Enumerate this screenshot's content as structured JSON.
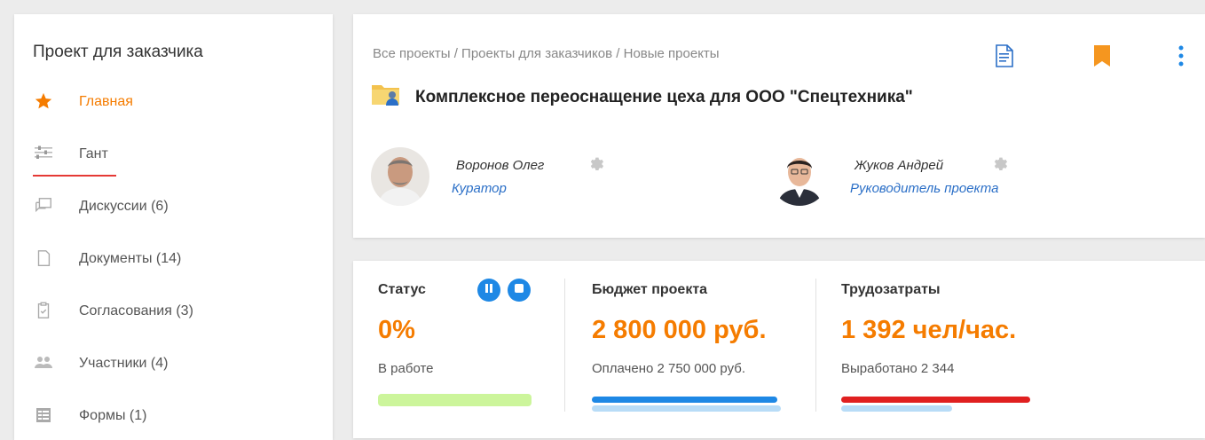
{
  "sidebar": {
    "title": "Проект для заказчика",
    "items": [
      {
        "label": "Главная",
        "icon": "star-icon"
      },
      {
        "label": "Гант",
        "icon": "gantt-icon"
      },
      {
        "label": "Дискуссии (6)",
        "icon": "discussions-icon"
      },
      {
        "label": "Документы (14)",
        "icon": "documents-icon"
      },
      {
        "label": "Согласования (3)",
        "icon": "approvals-icon"
      },
      {
        "label": "Участники (4)",
        "icon": "participants-icon"
      },
      {
        "label": "Формы (1)",
        "icon": "forms-icon"
      }
    ]
  },
  "header": {
    "breadcrumb": "Все проекты / Проекты для заказчиков / Новые проекты",
    "title": "Комплексное переоснащение цеха для ООО \"Спецтехника\"",
    "actions": [
      "document-icon",
      "bookmark-icon",
      "more-vertical-icon"
    ]
  },
  "people": [
    {
      "name": "Воронов Олег",
      "role": "Куратор"
    },
    {
      "name": "Жуков Андрей",
      "role": "Руководитель проекта"
    }
  ],
  "stats": {
    "status": {
      "title": "Статус",
      "value": "0%",
      "sub": "В работе",
      "progress": 0.0
    },
    "budget": {
      "title": "Бюджет проекта",
      "value": "2 800 000 руб.",
      "sub": "Оплачено 2 750 000 руб.",
      "paid_fraction": 0.98
    },
    "labor": {
      "title": "Трудозатраты",
      "value": "1 392 чел/час.",
      "sub": "Выработано 2 344",
      "worked_ratio": 1.68
    }
  },
  "colors": {
    "accent": "#f57c00",
    "link": "#2b6fc7",
    "primary_blue": "#1e88e5",
    "status_bar": "#ccf59b",
    "over_budget": "#e02020"
  }
}
